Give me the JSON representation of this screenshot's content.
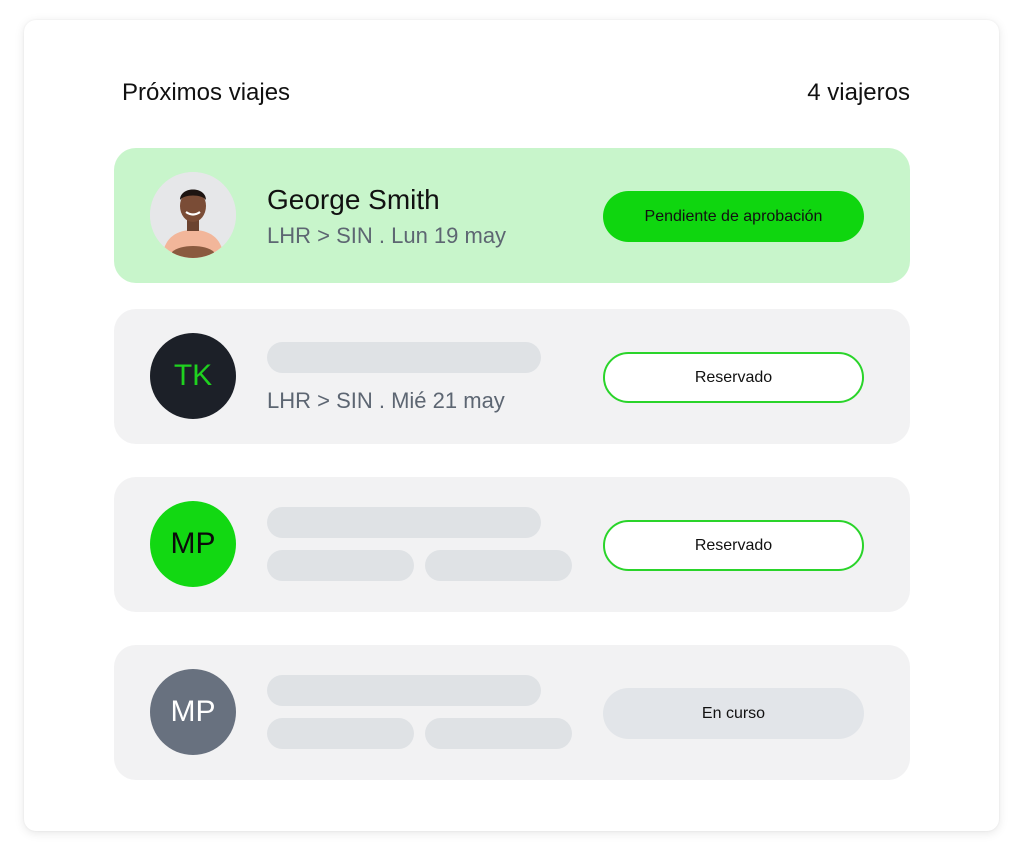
{
  "header": {
    "title": "Próximos viajes",
    "count": "4 viajeros"
  },
  "trips": [
    {
      "avatar_type": "photo",
      "name": "George Smith",
      "route": "LHR > SIN . Lun 19 may",
      "status": "Pendiente de aprobación"
    },
    {
      "avatar_type": "initials",
      "initials": "TK",
      "route": "LHR > SIN . Mié 21 may",
      "status": "Reservado"
    },
    {
      "avatar_type": "initials",
      "initials": "MP",
      "status": "Reservado"
    },
    {
      "avatar_type": "initials",
      "initials": "MP",
      "status": "En curso"
    }
  ],
  "colors": {
    "accent_green": "#0fd60f",
    "highlight_row": "#c8f5cb",
    "row_background": "#f2f2f3",
    "skeleton": "#dfe2e5"
  }
}
